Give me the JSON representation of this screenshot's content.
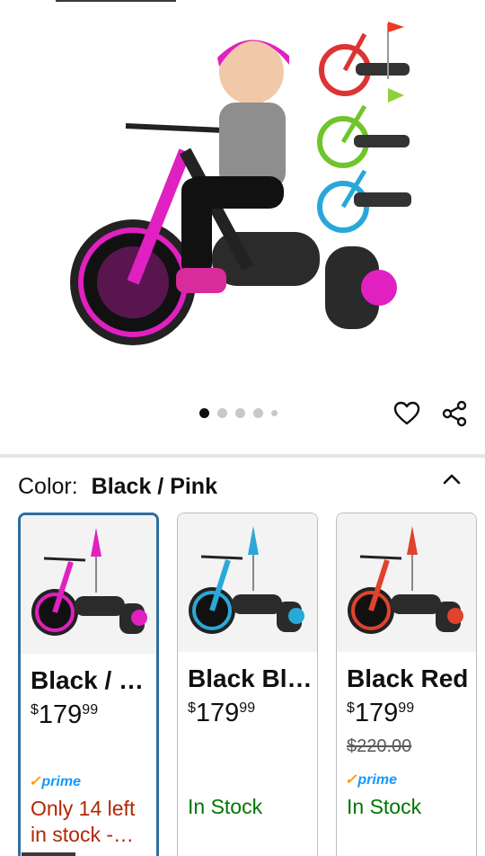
{
  "gallery": {
    "image_alt": "Kid riding pink drift trike with color variants",
    "dots_total": 5,
    "active_dot": 0
  },
  "actions": {
    "favorite_icon": "heart-outline-icon",
    "share_icon": "share-icon"
  },
  "color_selector": {
    "label": "Color:",
    "selected": "Black / Pink",
    "collapse_icon": "chevron-up-icon"
  },
  "variants": [
    {
      "name": "Black / …",
      "currency": "$",
      "price_whole": "179",
      "price_fraction": "99",
      "was_price": "",
      "prime": "prime",
      "stock": "Only 14 left in stock -…",
      "stock_status": "low",
      "accent": "#e020c0",
      "selected": true
    },
    {
      "name": "Black Bl…",
      "currency": "$",
      "price_whole": "179",
      "price_fraction": "99",
      "was_price": "",
      "prime": "",
      "stock": "In Stock",
      "stock_status": "in",
      "accent": "#29a9d8",
      "selected": false
    },
    {
      "name": "Black Red",
      "currency": "$",
      "price_whole": "179",
      "price_fraction": "99",
      "was_price": "$220.00",
      "prime": "prime",
      "stock": "In Stock",
      "stock_status": "in",
      "accent": "#e0422c",
      "selected": false
    }
  ],
  "colors": {
    "selected_border": "#2e6ea0",
    "prime_blue": "#1399ff",
    "prime_check": "#ff9900",
    "low_stock": "#b12704",
    "in_stock": "#007600"
  }
}
